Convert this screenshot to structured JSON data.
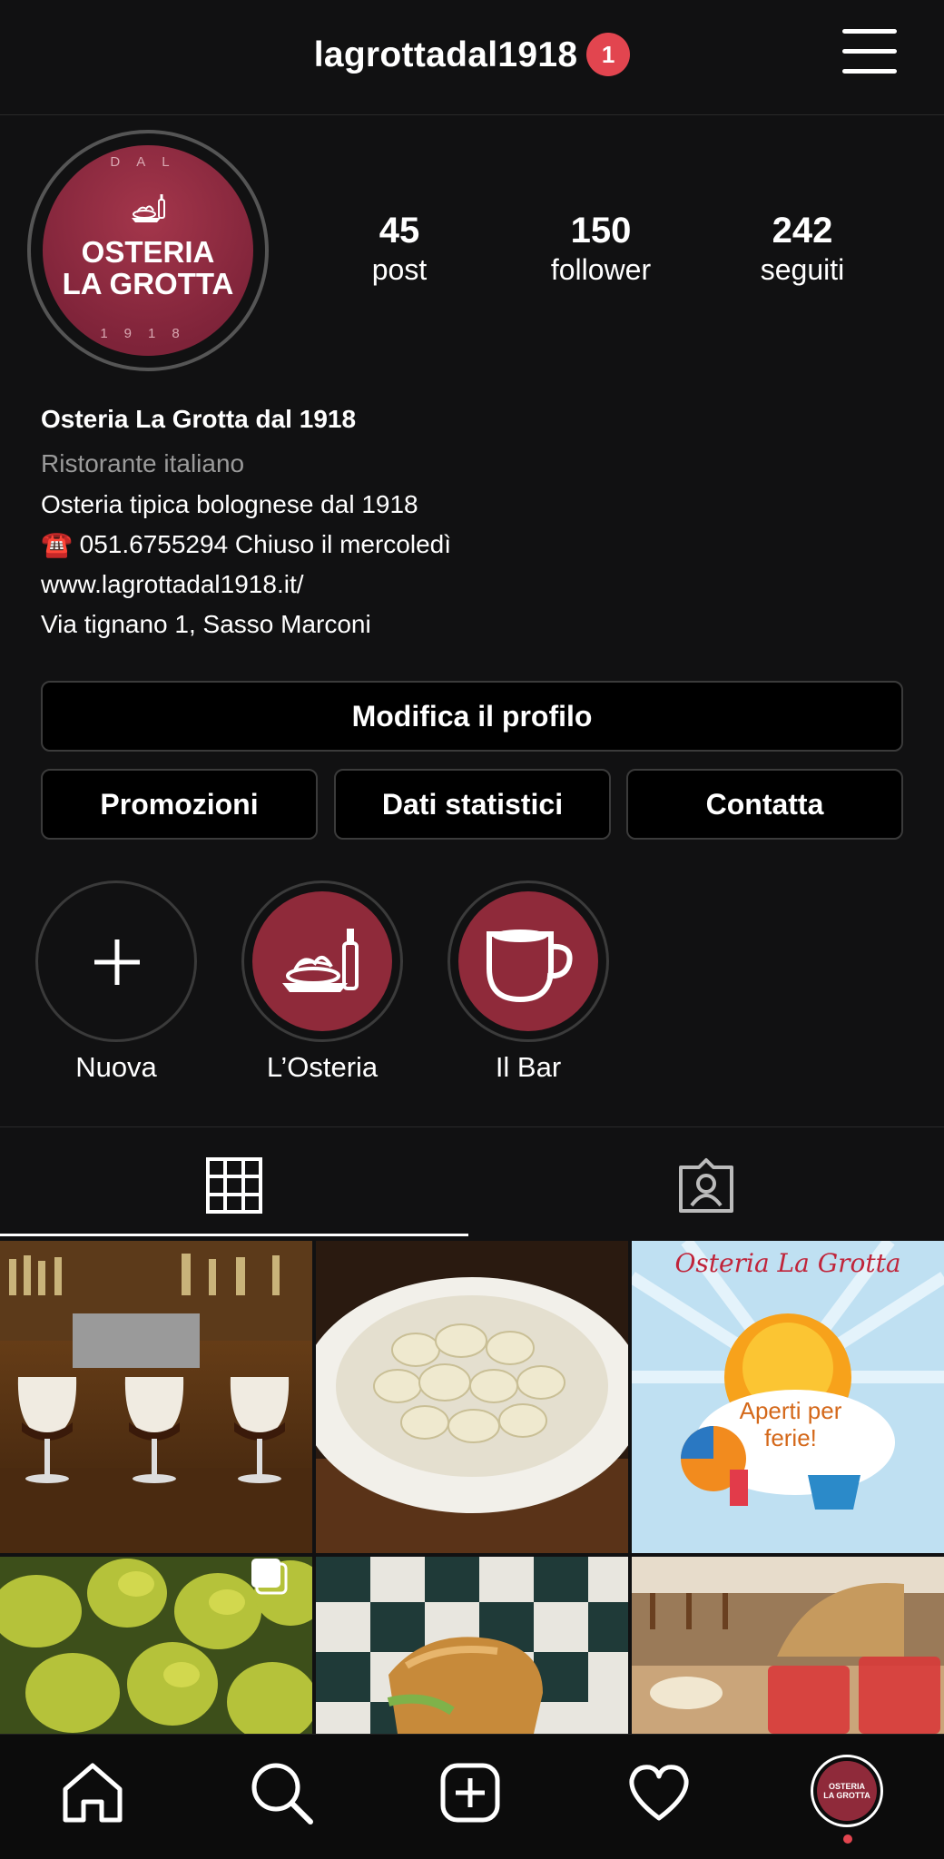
{
  "header": {
    "username": "lagrottadal1918",
    "notification_count": "1"
  },
  "avatar": {
    "top_text": "DAL",
    "line1": "OSTERIA",
    "line2": "LA GROTTA",
    "bottom_text": "1918"
  },
  "stats": [
    {
      "value": "45",
      "label": "post"
    },
    {
      "value": "150",
      "label": "follower"
    },
    {
      "value": "242",
      "label": "seguiti"
    }
  ],
  "bio": {
    "name": "Osteria La Grotta dal 1918",
    "category": "Ristorante italiano",
    "description": "Osteria tipica bolognese dal 1918",
    "phone_line": "☎️ 051.6755294 Chiuso il mercoledì",
    "website": "www.lagrottadal1918.it/",
    "address": "Via tignano 1, Sasso Marconi"
  },
  "buttons": {
    "edit_profile": "Modifica il profilo",
    "promotions": "Promozioni",
    "insights": "Dati statistici",
    "contact": "Contatta"
  },
  "highlights": [
    {
      "label": "Nuova"
    },
    {
      "label": "L’Osteria"
    },
    {
      "label": "Il Bar"
    }
  ],
  "posts": {
    "post3_title": "Osteria La Grotta",
    "post3_caption": "Aperti per ferie!"
  },
  "nav_avatar": {
    "line1": "OSTERIA",
    "line2": "LA GROTTA"
  },
  "colors": {
    "accent": "#e2454f",
    "brand": "#8f2a3a",
    "background": "#111112"
  }
}
